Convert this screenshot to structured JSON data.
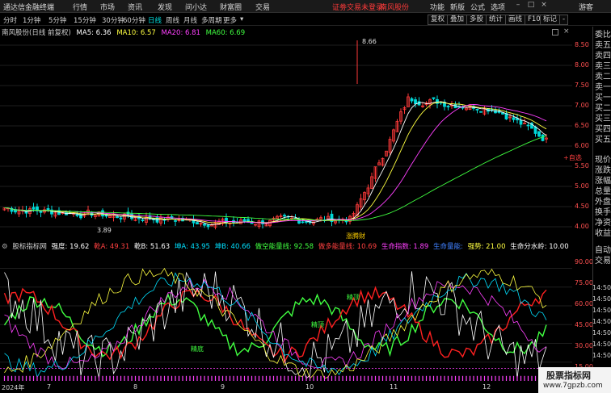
{
  "menubar": {
    "title": "通达信金融终端",
    "items": [
      "行情",
      "市场",
      "资讯",
      "发现",
      "问小达",
      "财富圈",
      "交易"
    ],
    "login_status": "证劵交易未登录",
    "stock_tag": "南风股份",
    "right_items": [
      "功能",
      "新版",
      "公式",
      "选项",
      "游客"
    ]
  },
  "periods": [
    "分时",
    "1分钟",
    "5分钟",
    "15分钟",
    "30分钟",
    "60分钟",
    "日线",
    "周线",
    "月线",
    "多周期",
    "更多"
  ],
  "active_period": "日线",
  "tools": [
    "复权",
    "叠加",
    "多股",
    "统计",
    "画线",
    "F10",
    "标记",
    "-"
  ],
  "main": {
    "stock_label": "南风股份(日线 前复权)",
    "ma": [
      {
        "label": "MA5: 6.36",
        "color": "#ffffff"
      },
      {
        "label": "MA10: 6.57",
        "color": "#ffff40"
      },
      {
        "label": "MA20: 6.81",
        "color": "#ff40ff"
      },
      {
        "label": "MA60: 6.69",
        "color": "#40ff40"
      }
    ],
    "high_label": "8.66",
    "low_label": "3.89",
    "event_label": "涨腾财"
  },
  "price_axis": [
    "8.50",
    "8.00",
    "7.50",
    "7.00",
    "6.50",
    "6.00",
    "5.50",
    "5.00",
    "4.50",
    "4.00"
  ],
  "indicator": {
    "name": "股标指标网",
    "params": [
      {
        "label": "强度: 19.62",
        "color": "#ffffff"
      },
      {
        "label": "乾A: 49.31",
        "color": "#ff4040"
      },
      {
        "label": "乾B: 51.63",
        "color": "#ffffff"
      },
      {
        "label": "坤A: 43.95",
        "color": "#00e0ff"
      },
      {
        "label": "坤B: 40.66",
        "color": "#00e0ff"
      },
      {
        "label": "做空能量线: 92.58",
        "color": "#40ff40"
      },
      {
        "label": "做多能量线: 10.69",
        "color": "#ff4040"
      },
      {
        "label": "生命指数: 1.89",
        "color": "#ff40ff"
      },
      {
        "label": "生命量能: ",
        "color": "#4080ff"
      },
      {
        "label": "强势: 21.00",
        "color": "#ffff40"
      },
      {
        "label": "生命分水岭: 10.00",
        "color": "#ffffff"
      }
    ],
    "labels": [
      "精顶",
      "精顶",
      "精底"
    ]
  },
  "ind_axis": [
    "90.00",
    "75.00",
    "60.00",
    "45.00",
    "30.00",
    "15.00"
  ],
  "time_axis": [
    "14:50",
    "14:50",
    "14:50",
    "14:50",
    "14:50",
    "14:50",
    "14:50"
  ],
  "date_axis": [
    "2024年",
    "7",
    "8",
    "9",
    "10",
    "11",
    "12"
  ],
  "side_panel": {
    "items": [
      "委比",
      "卖五",
      "卖四",
      "卖三",
      "卖二",
      "卖一",
      "买一",
      "买二",
      "买三",
      "买四",
      "买五",
      "现价",
      "涨跌",
      "涨幅",
      "总量",
      "外盘",
      "换手",
      "净资",
      "收益",
      "自动",
      "交易"
    ]
  },
  "watermark": {
    "line1": "股票指标网",
    "line2": "www.7gpzb.com"
  },
  "colors": {
    "up": "#ff3a3a",
    "down": "#00d8d8",
    "ma5": "#ffffff",
    "ma10": "#ffff40",
    "ma20": "#ff40ff",
    "ma60": "#40ff40"
  }
}
